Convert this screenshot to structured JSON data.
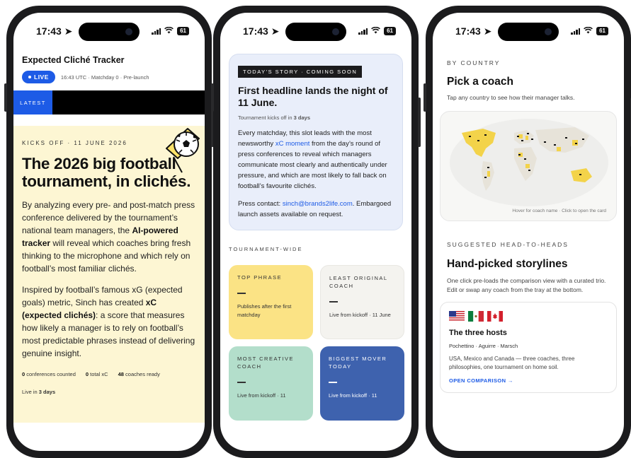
{
  "status": {
    "time": "17:43",
    "battery": "61"
  },
  "phone1": {
    "header_title": "Expected Cliché Tracker",
    "live_label": "LIVE",
    "live_meta": "16:43 UTC · Matchday 0 · Pre-launch",
    "latest_tag": "LATEST",
    "kicker": "KICKS OFF · 11 JUNE 2026",
    "title": "The 2026 big football tournament, in clichés.",
    "para1_a": "By analyzing every pre- and post-match press conference delivered by the tournament’s national team managers, the ",
    "para1_b": "AI-powered tracker",
    "para1_c": " will reveal which coaches bring fresh thinking to the microphone and which rely on football’s most familiar clichés.",
    "para2_a": "Inspired by football’s famous xG (expected goals) metric, Sinch has created ",
    "para2_b": "xC (expected clichés)",
    "para2_c": ": a score that measures how likely a manager is to rely on football’s most predictable phrases instead of delivering genuine insight.",
    "stat1_num": "0",
    "stat1_label": "conferences counted",
    "stat2_num": "0",
    "stat2_label": "total xC",
    "stat3_num": "48",
    "stat3_label": "coaches ready",
    "livein_label": "Live in",
    "livein_value": "3 days"
  },
  "phone2": {
    "story_tag": "TODAY'S STORY · COMING SOON",
    "story_title": "First headline lands the night of 11 June.",
    "story_sub_a": "Tournament kicks off in ",
    "story_sub_b": "3 days",
    "body_a": "Every matchday, this slot leads with the most newsworthy ",
    "body_link": "xC moment",
    "body_b": " from the day’s round of press conferences to reveal which managers communicate most clearly and authentically under pressure, and which are most likely to fall back on football’s favourite clichés.",
    "contact_a": "Press contact: ",
    "contact_link": "sinch@brands2life.com",
    "contact_b": ". Embargoed launch assets available on request.",
    "section": "TOURNAMENT-WIDE",
    "tiles": [
      {
        "label": "TOP PHRASE",
        "dash": "—",
        "desc": "Publishes after the first matchday",
        "bg": "#fbe385",
        "fg": "#333333"
      },
      {
        "label": "LEAST ORIGINAL COACH",
        "dash": "—",
        "desc": "Live from kickoff · 11 June",
        "bg": "#f4f3ef",
        "fg": "#333333"
      },
      {
        "label": "MOST CREATIVE COACH",
        "dash": "—",
        "desc": "Live from kickoff · 11",
        "bg": "#b3decb",
        "fg": "#333333"
      },
      {
        "label": "BIGGEST MOVER TODAY",
        "dash": "—",
        "desc": "Live from kickoff · 11",
        "bg": "#3e62ae",
        "fg": "#ffffff"
      }
    ]
  },
  "phone3": {
    "by_country": "BY COUNTRY",
    "pick_title": "Pick a coach",
    "pick_sub": "Tap any country to see how their manager talks.",
    "map_hint": "Hover for coach name · Click to open the card",
    "suggested": "SUGGESTED HEAD-TO-HEADS",
    "storylines_title": "Hand-picked storylines",
    "storylines_sub": "One click pre-loads the comparison view with a curated trio. Edit or swap any coach from the tray at the bottom.",
    "card_title": "The three hosts",
    "card_names": "Pochettino · Aguirre · Marsch",
    "card_desc": "USA, Mexico and Canada — three coaches, three philosophies, one tournament on home soil.",
    "card_cta": "OPEN COMPARISON →"
  }
}
